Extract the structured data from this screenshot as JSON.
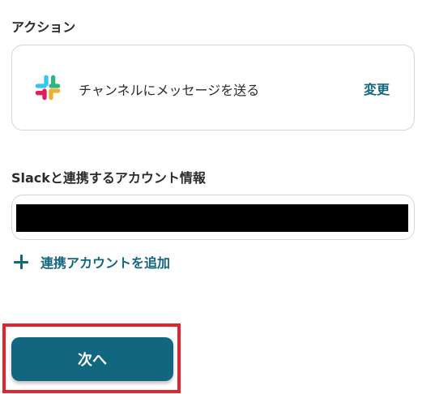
{
  "action_section": {
    "label": "アクション",
    "card": {
      "app_icon": "slack-icon",
      "action_name": "チャンネルにメッセージを送る",
      "change_label": "変更"
    }
  },
  "account_section": {
    "label": "Slackと連携するアカウント情報",
    "account_value": "",
    "add_account_label": "連携アカウントを追加"
  },
  "footer": {
    "next_label": "次へ"
  },
  "colors": {
    "accent": "#13667f",
    "highlight": "#e0262b",
    "border": "#d6d6d6",
    "slack_blue": "#36C5F0",
    "slack_green": "#2EB67D",
    "slack_yellow": "#ECB22E",
    "slack_red": "#E01E5A"
  }
}
